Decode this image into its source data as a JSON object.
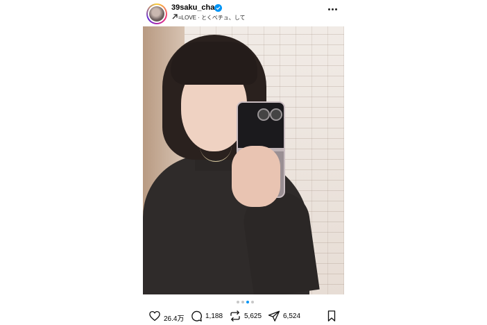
{
  "post": {
    "username": "39saku_chan",
    "verified_icon": "verified-badge-icon",
    "music_icon": "arrow-up-right-icon",
    "music_text": "=LOVE · とくべチュ、して",
    "more_icon": "more-dots-icon"
  },
  "carousel": {
    "total": 4,
    "active_index": 2
  },
  "actions": {
    "likes": "26.4万",
    "comments": "1,188",
    "reposts": "5,625",
    "shares": "6,524"
  },
  "colors": {
    "verified": "#0095f6",
    "active_dot": "#0095f6",
    "inactive_dot": "#c7c7c7"
  }
}
